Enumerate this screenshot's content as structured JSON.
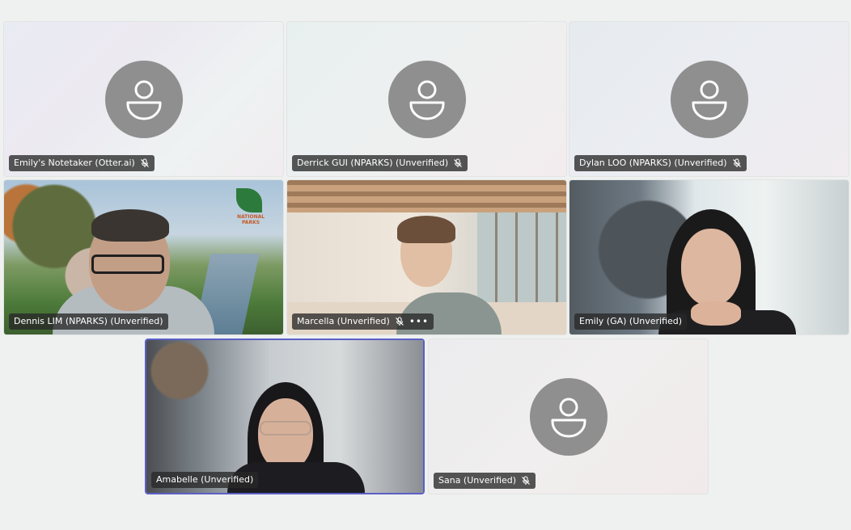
{
  "meeting": {
    "participants": [
      {
        "name": "Emily's Notetaker (Otter.ai)",
        "muted": true,
        "video": false
      },
      {
        "name": "Derrick GUI (NPARKS) (Unverified)",
        "muted": true,
        "video": false
      },
      {
        "name": "Dylan LOO (NPARKS) (Unverified)",
        "muted": true,
        "video": false
      },
      {
        "name": "Dennis LIM (NPARKS) (Unverified)",
        "muted": false,
        "video": true
      },
      {
        "name": "Marcella (Unverified)",
        "muted": true,
        "video": true,
        "more_options": true
      },
      {
        "name": "Emily (GA) (Unverified)",
        "muted": false,
        "video": true
      },
      {
        "name": "Amabelle (Unverified)",
        "muted": false,
        "video": true,
        "active_speaker": true
      },
      {
        "name": "Sana (Unverified)",
        "muted": true,
        "video": false
      }
    ],
    "background_logo_text": "NATIONAL PARKS",
    "icons": {
      "avatar": "person-icon",
      "mic_off": "mic-off-icon",
      "more": "more-options-icon"
    },
    "colors": {
      "active_border": "#5b5fc7",
      "avatar_circle": "#8f8f8f",
      "label_bg": "#2a2a2a"
    }
  }
}
